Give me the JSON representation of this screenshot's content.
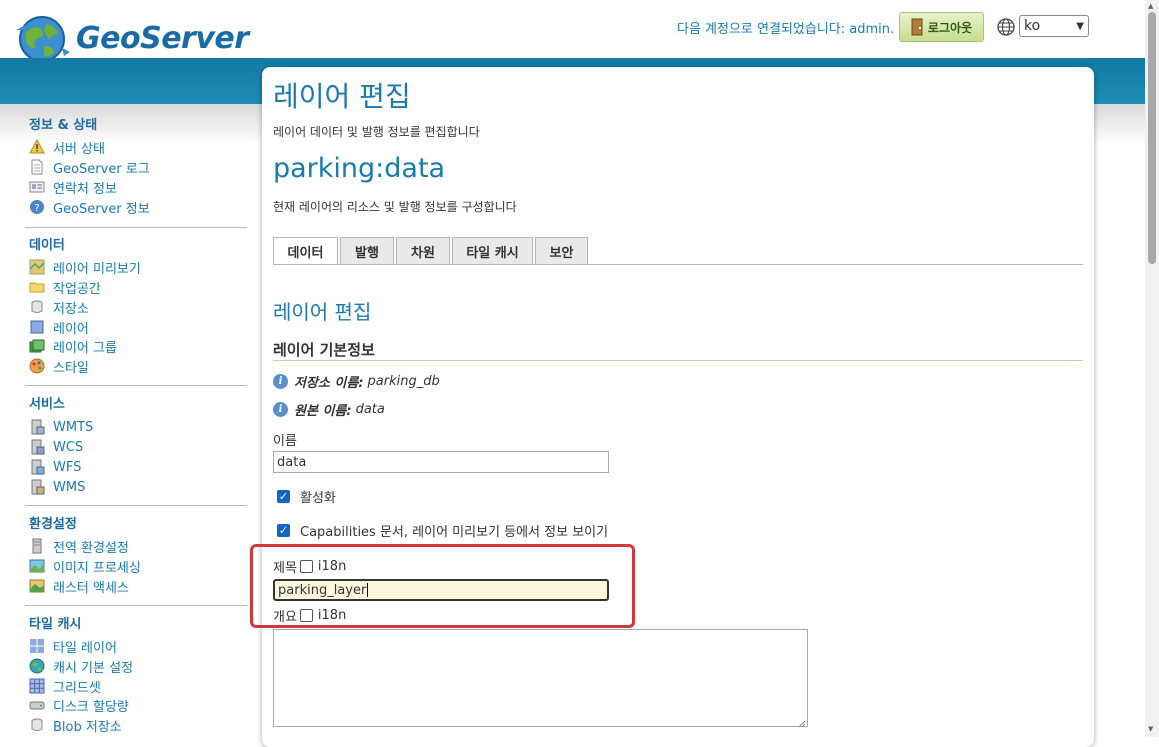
{
  "header": {
    "logo_text": "GeoServer",
    "user_info": "다음 계정으로 연결되었습니다: admin.",
    "logout_label": "로그아웃",
    "language": "ko"
  },
  "sidebar": {
    "sections": [
      {
        "title": "정보 & 상태",
        "items": [
          {
            "label": "서버 상태",
            "icon": "warning-icon"
          },
          {
            "label": "GeoServer 로그",
            "icon": "document-icon"
          },
          {
            "label": "연락처 정보",
            "icon": "contact-card-icon"
          },
          {
            "label": "GeoServer 정보",
            "icon": "help-icon"
          }
        ]
      },
      {
        "title": "데이터",
        "items": [
          {
            "label": "레이어 미리보기",
            "icon": "map-preview-icon"
          },
          {
            "label": "작업공간",
            "icon": "folder-icon"
          },
          {
            "label": "저장소",
            "icon": "database-icon"
          },
          {
            "label": "레이어",
            "icon": "layer-icon"
          },
          {
            "label": "레이어 그룹",
            "icon": "layer-group-icon"
          },
          {
            "label": "스타일",
            "icon": "palette-icon"
          }
        ]
      },
      {
        "title": "서비스",
        "items": [
          {
            "label": "WMTS",
            "icon": "server-icon"
          },
          {
            "label": "WCS",
            "icon": "server-icon"
          },
          {
            "label": "WFS",
            "icon": "server-icon"
          },
          {
            "label": "WMS",
            "icon": "server-icon"
          }
        ]
      },
      {
        "title": "환경설정",
        "items": [
          {
            "label": "전역 환경설정",
            "icon": "server-settings-icon"
          },
          {
            "label": "이미지 프로세싱",
            "icon": "image-processing-icon"
          },
          {
            "label": "래스터 액세스",
            "icon": "raster-icon"
          }
        ]
      },
      {
        "title": "타일 캐시",
        "items": [
          {
            "label": "타일 레이어",
            "icon": "tile-layer-icon"
          },
          {
            "label": "캐시 기본 설정",
            "icon": "globe-icon"
          },
          {
            "label": "그리드셋",
            "icon": "grid-icon"
          },
          {
            "label": "디스크 할당량",
            "icon": "disk-icon"
          },
          {
            "label": "Blob 저장소",
            "icon": "blob-store-icon"
          }
        ]
      }
    ]
  },
  "main": {
    "page_title": "레이어 편집",
    "page_description": "레이어 데이터 및 발행 정보를 편집합니다",
    "layer_name": "parking:data",
    "layer_description": "현재 레이어의 리소스 및 발행 정보를 구성합니다",
    "tabs": [
      {
        "label": "데이터",
        "active": true
      },
      {
        "label": "발행",
        "active": false
      },
      {
        "label": "차원",
        "active": false
      },
      {
        "label": "타일 캐시",
        "active": false
      },
      {
        "label": "보안",
        "active": false
      }
    ],
    "sub_title": "레이어 편집",
    "basic_info_heading": "레이어 기본정보",
    "store_label": "저장소 이름:",
    "store_value": "parking_db",
    "native_label": "원본 이름:",
    "native_value": "data",
    "name_label": "이름",
    "name_value": "data",
    "enabled_label": "활성화",
    "enabled_checked": true,
    "advertised_label": "Capabilities 문서, 레이어 미리보기 등에서 정보 보이기",
    "advertised_checked": true,
    "title_label": "제목",
    "title_i18n_label": "i18n",
    "title_value": "parking_layer",
    "abstract_label": "개요",
    "abstract_i18n_label": "i18n",
    "abstract_value": ""
  },
  "colors": {
    "brand_blue": "#1a7ab0",
    "header_band": "#1279a3",
    "highlight_red": "#d0383c",
    "checkbox_blue": "#1466c0"
  }
}
